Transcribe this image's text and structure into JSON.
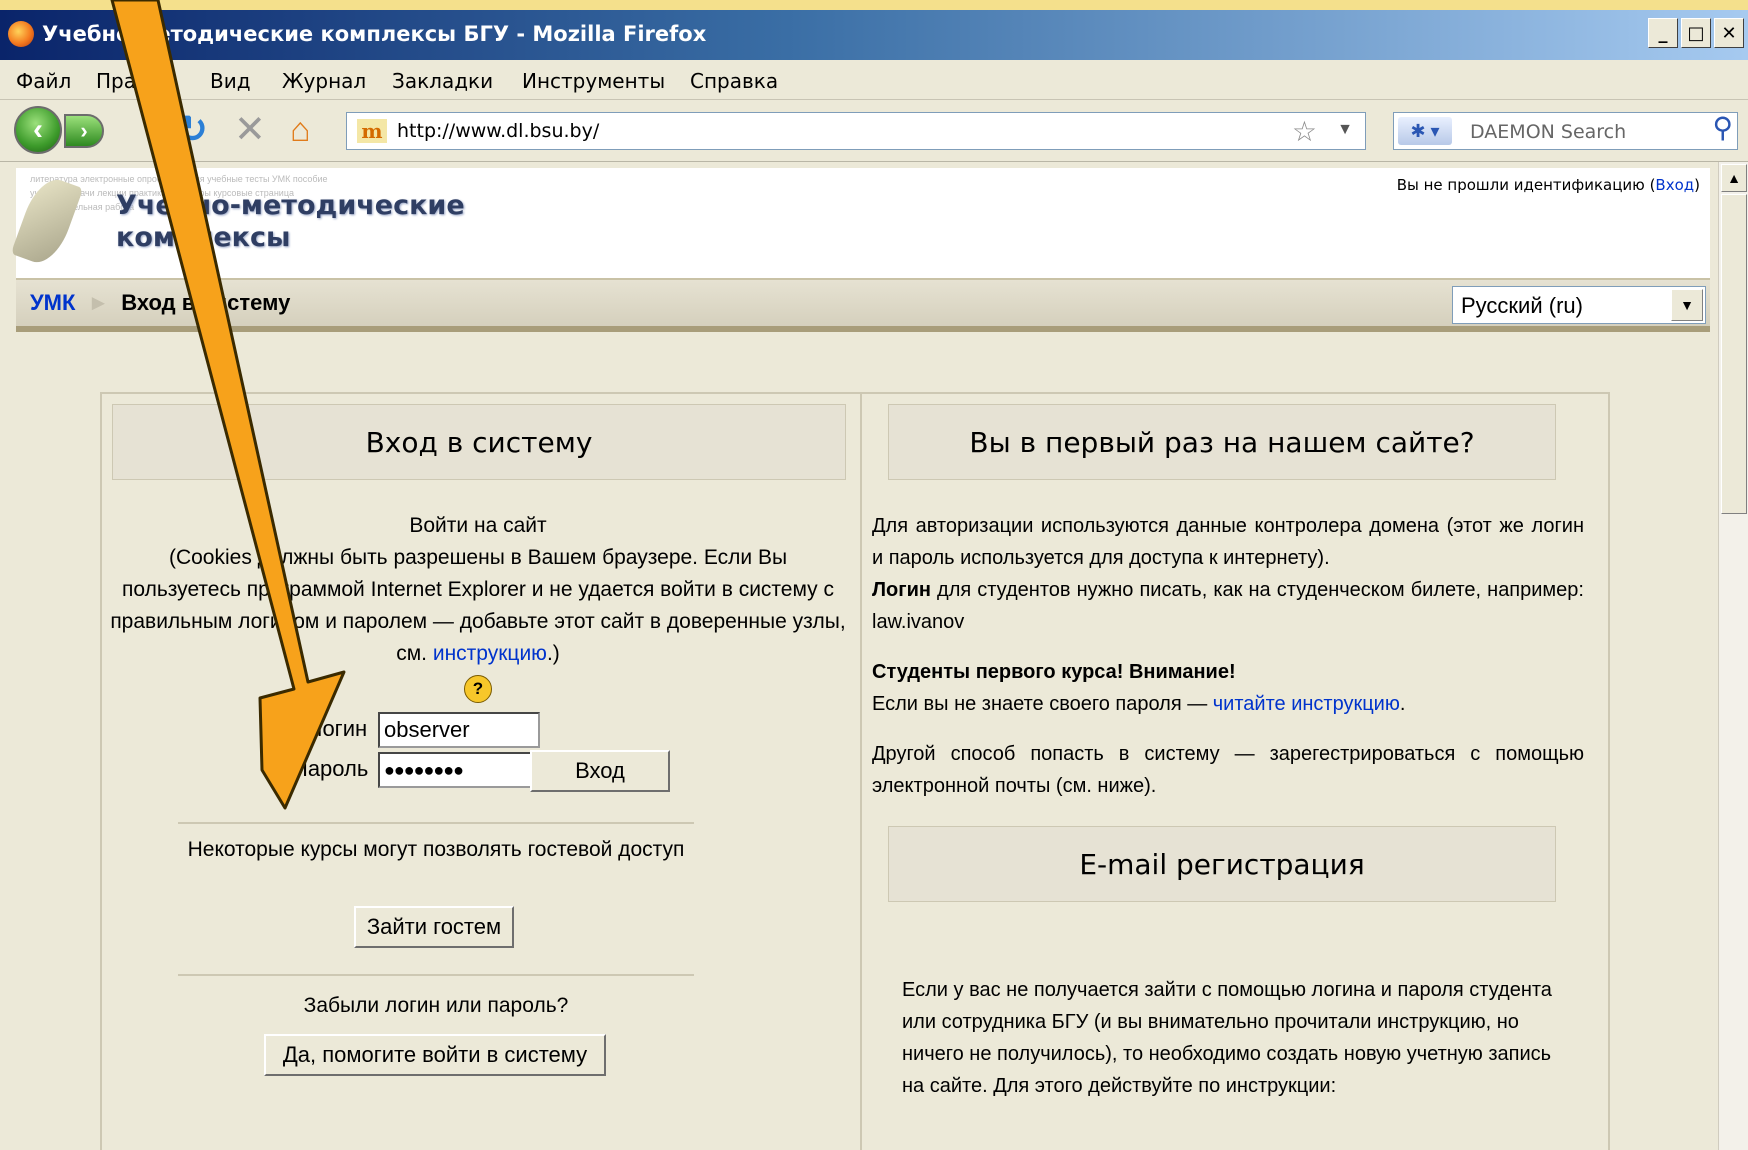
{
  "window": {
    "title": "Учебно-методические комплексы БГУ - Mozilla Firefox",
    "minimize": "_",
    "maximize": "□",
    "close": "✕"
  },
  "menu": [
    "Файл",
    "Правка",
    "Вид",
    "Журнал",
    "Закладки",
    "Инструменты",
    "Справка"
  ],
  "toolbar": {
    "url": "http://www.dl.bsu.by/",
    "favicon_text": "m",
    "search_placeholder": "DAEMON Search"
  },
  "site": {
    "logo_line1": "Учебно-методические",
    "logo_line2": "комплексы",
    "logo_words": "литература  электронные  опросы  задания  учебные  тесты  УМК  пособие  учебник  задачи  лекции  практика  семинары  курсовые  страница  самостоятельная  работа  ",
    "login_status_prefix": "Вы не прошли идентификацию (",
    "login_status_link": "Вход",
    "login_status_suffix": ")"
  },
  "breadcrumb": {
    "home": "УМК",
    "separator": "►",
    "current": "Вход в систему"
  },
  "language_select": {
    "value": "Русский (ru)"
  },
  "login_panel": {
    "heading": "Вход в систему",
    "intro_title": "Войти на сайт",
    "intro_body": "(Cookies должны быть разрешены в Вашем браузере. Если Вы пользуетесь программой Internet Explorer и не удается войти в систему с правильным логином и паролем — добавьте этот сайт в доверенные узлы, см. ",
    "intro_link": "инструкцию",
    "intro_end": ".)",
    "help_icon": "?",
    "login_label": "Логин",
    "login_value": "observer",
    "password_label": "Пароль",
    "password_value": "●●●●●●●●",
    "submit": "Вход",
    "guest_text": "Некоторые курсы могут позволять гостевой доступ",
    "guest_button": "Зайти гостем",
    "forgot_text": "Забыли логин или пароль?",
    "forgot_button": "Да, помогите войти в систему"
  },
  "first_time_panel": {
    "heading": "Вы в первый раз на нашем сайте?",
    "p1": "Для авторизации используются данные контролера домена (этот же логин и пароль используется для доступа к интернету).",
    "p2_bold": "Логин",
    "p2_rest": " для студентов нужно писать, как на студенческом билете, например: law.ivanov",
    "p3_bold": "Студенты первого курса! Внимание!",
    "p3_text": "Если вы не знаете своего пароля — ",
    "p3_link": "читайте инструкцию",
    "p3_end": ".",
    "p4": "Другой способ попасть в систему — зарегестрироваться с помощью электронной почты (см. ниже)."
  },
  "email_panel": {
    "heading": "E-mail регистрация",
    "text": "Если у вас не получается зайти с помощью логина и пароля студента или сотрудника БГУ (и вы внимательно прочитали инструкцию, но ничего не получилось), то необходимо создать новую учетную запись на сайте. Для этого действуйте по инструкции:"
  },
  "annotation": {
    "arrow_color": "#f7a21b"
  }
}
